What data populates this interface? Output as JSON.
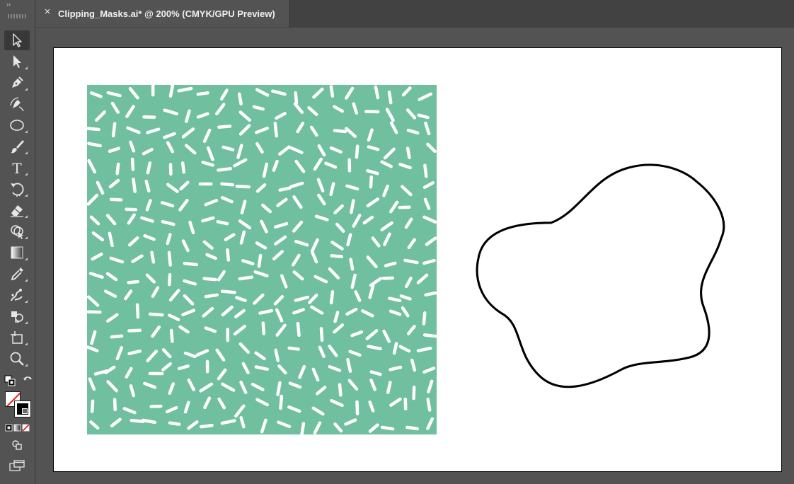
{
  "document_tab": {
    "close_glyph": "×",
    "title": "Clipping_Masks.ai* @ 200% (CMYK/GPU Preview)"
  },
  "toolbar": {
    "collapse_glyph": "››",
    "tools": [
      {
        "name": "selection-tool",
        "icon": "arrow-outline-icon",
        "selected": true
      },
      {
        "name": "direct-selection-tool",
        "icon": "arrow-filled-icon"
      },
      {
        "name": "pen-tool",
        "icon": "pen-icon"
      },
      {
        "name": "curvature-tool",
        "icon": "curvature-pen-icon"
      },
      {
        "name": "ellipse-tool",
        "icon": "ellipse-icon"
      },
      {
        "name": "paintbrush-tool",
        "icon": "brush-icon"
      },
      {
        "name": "type-tool",
        "icon": "type-icon",
        "glyph": "T"
      },
      {
        "name": "rotate-tool",
        "icon": "rotate-icon"
      },
      {
        "name": "eraser-tool",
        "icon": "eraser-icon"
      },
      {
        "name": "shape-builder-tool",
        "icon": "shape-builder-icon"
      },
      {
        "name": "gradient-tool",
        "icon": "gradient-icon"
      },
      {
        "name": "eyedropper-tool",
        "icon": "eyedropper-icon"
      },
      {
        "name": "puppet-warp-tool",
        "icon": "puppet-warp-icon"
      },
      {
        "name": "symbol-sprayer-tool",
        "icon": "symbol-sprayer-icon"
      },
      {
        "name": "artboard-tool",
        "icon": "artboard-icon"
      },
      {
        "name": "zoom-tool",
        "icon": "zoom-icon"
      }
    ],
    "fill": "none",
    "stroke": "#000000"
  },
  "canvas": {
    "artboard_color": "#ffffff",
    "pattern_fill": "#70bf9e",
    "pattern_mark_color": "#ffffff",
    "blob_stroke": "#000000"
  }
}
